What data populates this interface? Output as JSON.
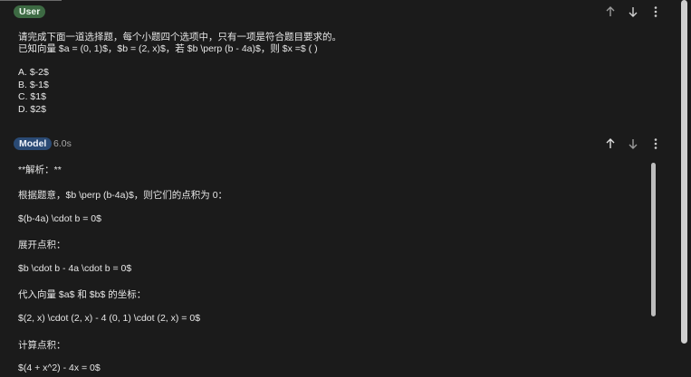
{
  "user": {
    "badge": "User",
    "lines": [
      "请完成下面一道选择题，每个小题四个选项中，只有一项是符合题目要求的。",
      "已知向量 $a = (0, 1)$，$b = (2, x)$，若 $b \\perp (b - 4a)$，则 $x =$ ( )",
      "A. $-2$",
      "B. $-1$",
      "C. $1$",
      "D. $2$"
    ]
  },
  "model": {
    "badge": "Model",
    "timing": "6.0s",
    "lines": [
      "**解析：**",
      "根据题意，$b \\perp (b-4a)$，则它们的点积为 0：",
      "$(b-4a) \\cdot b = 0$",
      "展开点积：",
      "$b \\cdot b - 4a \\cdot b = 0$",
      "代入向量 $a$ 和 $b$ 的坐标：",
      "$(2, x) \\cdot (2, x) - 4 (0, 1) \\cdot (2, x) = 0$",
      "计算点积：",
      "$(4 + x^2) - 4x = 0$"
    ]
  },
  "icons": {
    "up": "arrow-up-icon",
    "down": "arrow-down-icon",
    "more": "more-vert-icon"
  }
}
